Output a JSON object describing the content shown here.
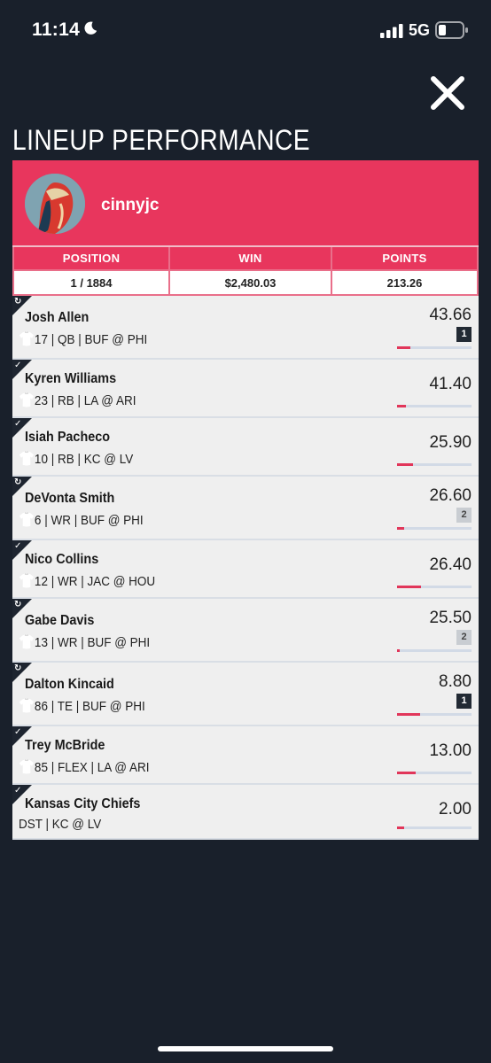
{
  "status_bar": {
    "time": "11:14",
    "network": "5G"
  },
  "title": "LINEUP PERFORMANCE",
  "user": {
    "name": "cinnyjc"
  },
  "stats": {
    "headers": [
      "POSITION",
      "WIN",
      "POINTS"
    ],
    "values": [
      "1 / 1884",
      "$2,480.03",
      "213.26"
    ]
  },
  "players": [
    {
      "name": "Josh Allen",
      "number": "17",
      "pos": "QB",
      "away": "BUF",
      "home": "PHI",
      "points": "43.66",
      "badge": "1",
      "badge_style": "dark",
      "status": "swap",
      "progress": 0.18
    },
    {
      "name": "Kyren Williams",
      "number": "23",
      "pos": "RB",
      "away": "LA",
      "home": "ARI",
      "points": "41.40",
      "badge": "",
      "badge_style": "",
      "status": "check",
      "progress": 0.12
    },
    {
      "name": "Isiah Pacheco",
      "number": "10",
      "pos": "RB",
      "away": "KC",
      "home": "LV",
      "points": "25.90",
      "badge": "",
      "badge_style": "",
      "status": "check",
      "progress": 0.22
    },
    {
      "name": "DeVonta Smith",
      "number": "6",
      "pos": "WR",
      "away": "BUF",
      "home": "PHI",
      "points": "26.60",
      "badge": "2",
      "badge_style": "light",
      "status": "swap",
      "progress": 0.1
    },
    {
      "name": "Nico Collins",
      "number": "12",
      "pos": "WR",
      "away": "JAC",
      "home": "HOU",
      "points": "26.40",
      "badge": "",
      "badge_style": "",
      "status": "check",
      "progress": 0.32
    },
    {
      "name": "Gabe Davis",
      "number": "13",
      "pos": "WR",
      "away": "BUF",
      "home": "PHI",
      "points": "25.50",
      "badge": "2",
      "badge_style": "light",
      "status": "swap",
      "progress": 0.04
    },
    {
      "name": "Dalton Kincaid",
      "number": "86",
      "pos": "TE",
      "away": "BUF",
      "home": "PHI",
      "points": "8.80",
      "badge": "1",
      "badge_style": "dark",
      "status": "swap",
      "progress": 0.31
    },
    {
      "name": "Trey McBride",
      "number": "85",
      "pos": "FLEX",
      "away": "LA",
      "home": "ARI",
      "points": "13.00",
      "badge": "",
      "badge_style": "",
      "status": "check",
      "progress": 0.25
    },
    {
      "name": "Kansas City Chiefs",
      "number": "",
      "pos": "DST",
      "away": "KC",
      "home": "LV",
      "points": "2.00",
      "badge": "",
      "badge_style": "",
      "status": "check",
      "progress": 0.1
    }
  ]
}
